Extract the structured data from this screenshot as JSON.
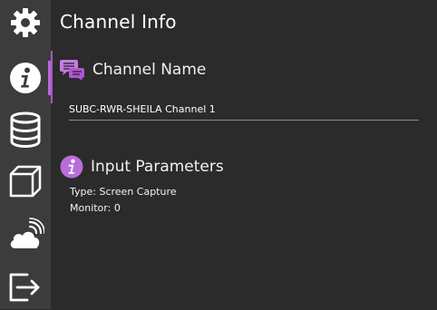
{
  "page": {
    "title": "Channel Info"
  },
  "sidebar": {
    "items": [
      {
        "name": "settings",
        "icon": "gear-icon"
      },
      {
        "name": "info",
        "icon": "info-icon",
        "active": true
      },
      {
        "name": "database",
        "icon": "database-icon"
      },
      {
        "name": "cube",
        "icon": "cube-icon"
      },
      {
        "name": "cloud",
        "icon": "cloud-broadcast-icon"
      },
      {
        "name": "exit",
        "icon": "exit-icon"
      }
    ]
  },
  "channel_name": {
    "heading": "Channel Name",
    "value": "SUBC-RWR-SHEILA Channel 1"
  },
  "input_parameters": {
    "heading": "Input Parameters",
    "type_line": "Type: Screen Capture",
    "monitor_line": "Monitor: 0"
  },
  "colors": {
    "accent": "#b86ad6",
    "sidebar_bg": "#3c3c3c",
    "main_bg": "#2b2b2b"
  }
}
